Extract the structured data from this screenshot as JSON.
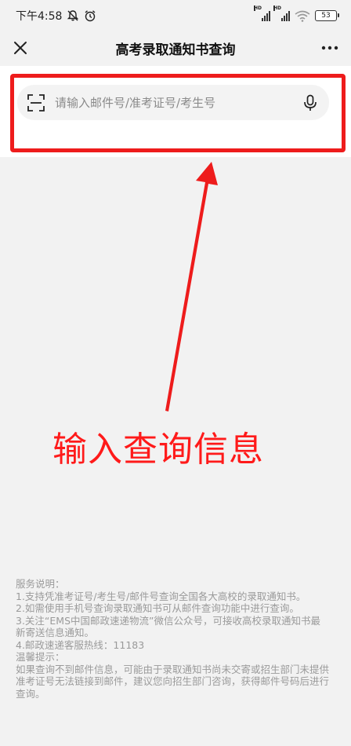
{
  "status_bar": {
    "time": "下午4:58",
    "battery": "53",
    "signal_label": "HD"
  },
  "nav": {
    "title": "高考录取通知书查询"
  },
  "search": {
    "placeholder": "请输入邮件号/准考证号/考生号",
    "value": ""
  },
  "annotation": {
    "text": "输入查询信息",
    "color": "#ff1a1a"
  },
  "notes": {
    "heading": "服务说明：",
    "items": [
      "1.支持凭准考证号/考生号/邮件号查询全国各大高校的录取通知书。",
      "2.如需使用手机号查询录取通知书可从邮件查询功能中进行查询。",
      "3.关注“EMS中国邮政速递物流”微信公众号，可接收高校录取通知书最新寄送信息通知。",
      "4.邮政速递客服热线：11183"
    ],
    "tip_heading": "温馨提示：",
    "tip_text": "如果查询不到邮件信息，可能由于录取通知书尚未交寄或招生部门未提供准考证号无法链接到邮件，建议您向招生部门咨询，获得邮件号码后进行查询。"
  },
  "colors": {
    "highlight": "#ee1c1c",
    "background": "#f2f2f2",
    "note_text": "#9a9a9a"
  }
}
